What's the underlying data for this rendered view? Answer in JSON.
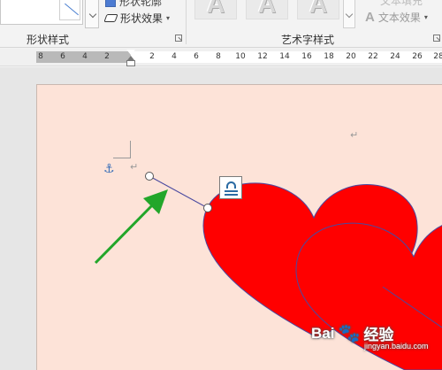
{
  "ribbon": {
    "shape_outline_label": "形状轮廓",
    "shape_effect_label": "形状效果",
    "shape_styles_group": "形状样式",
    "wordart_styles_group": "艺术字样式",
    "wordart_sample": "A",
    "text_fill_label": "文本填充",
    "text_effect_label": "文本效果"
  },
  "ruler": {
    "labels": [
      "8",
      "6",
      "4",
      "2",
      "2",
      "4",
      "6",
      "8",
      "10",
      "12",
      "14",
      "16",
      "18",
      "20",
      "22",
      "24",
      "26",
      "28"
    ]
  },
  "document": {
    "paragraph_mark": "↵",
    "anchor_symbol": "⚓",
    "heart_color": "#ff0000",
    "page_color": "#fde3d8",
    "arrow_color": "#22a62a"
  },
  "watermark": {
    "brand": "Bai",
    "brand2": "经验",
    "domain": "jingyan.baidu.com"
  }
}
